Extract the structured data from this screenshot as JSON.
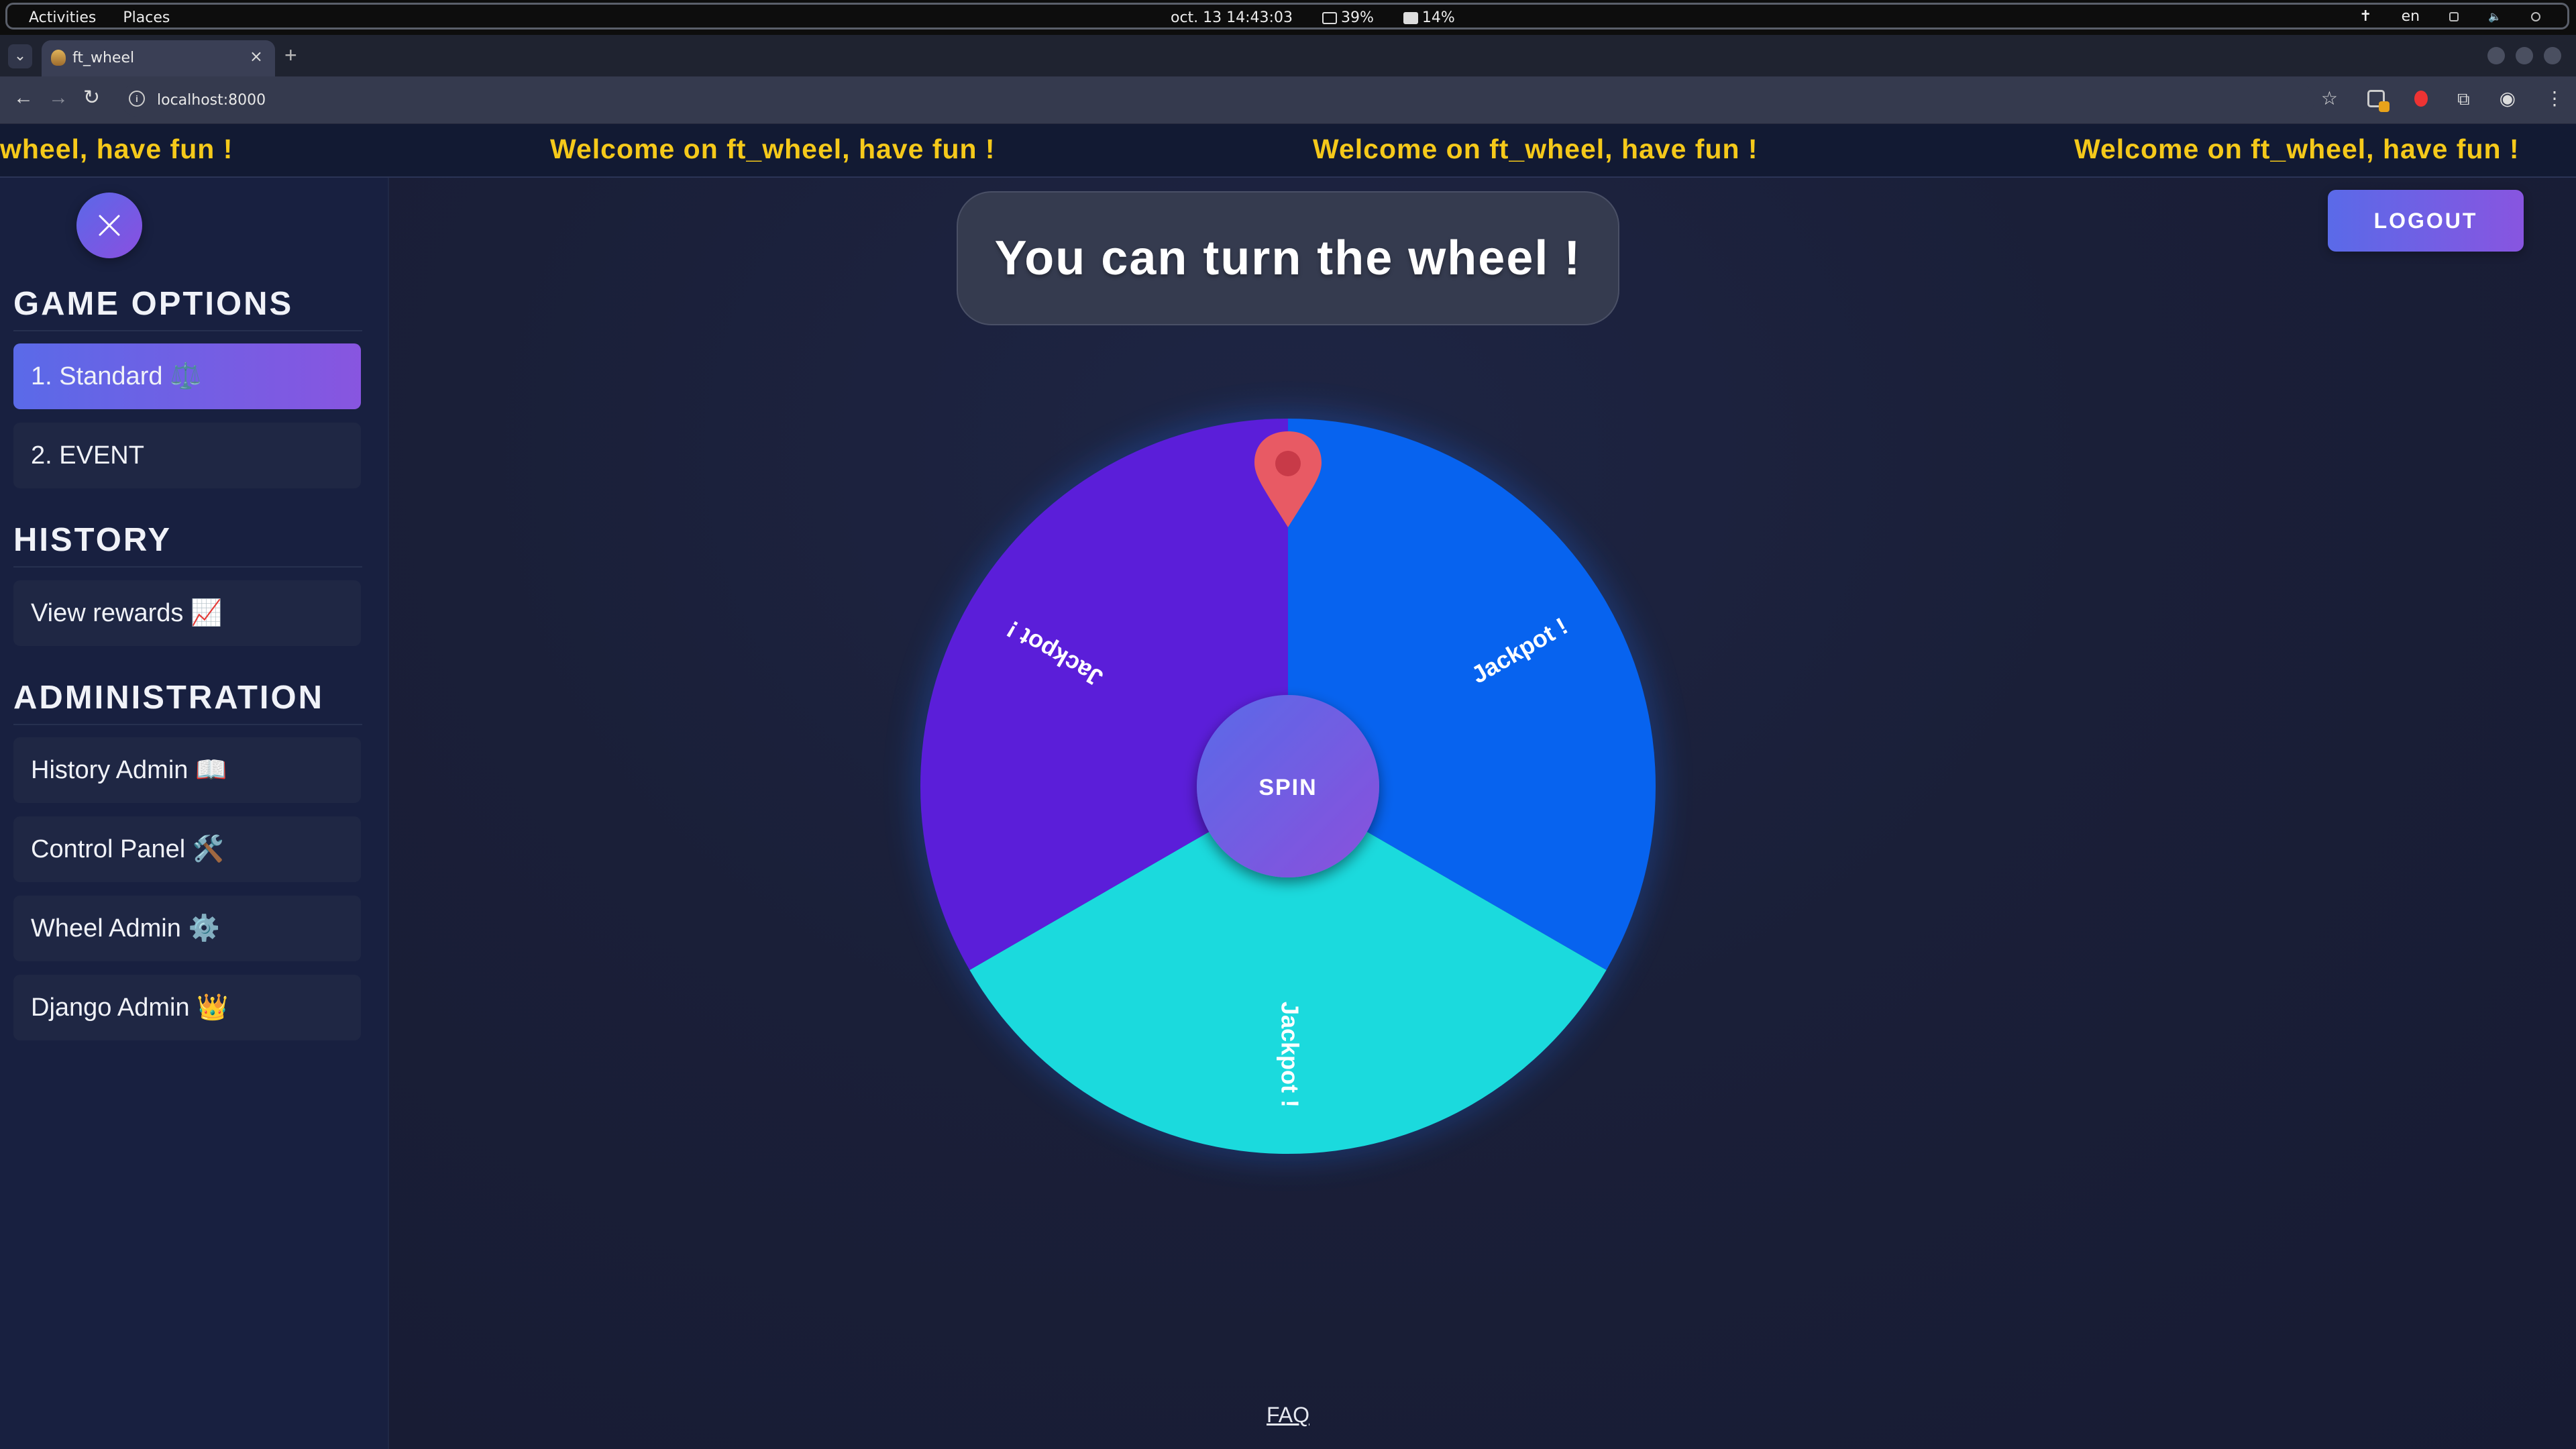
{
  "system_bar": {
    "activities": "Activities",
    "places": "Places",
    "datetime": "oct. 13  14:43:03",
    "cpu": "39%",
    "mem": "14%",
    "lang": "en"
  },
  "browser": {
    "tab_title": "ft_wheel",
    "url": "localhost:8000"
  },
  "banner": {
    "items": [
      "wheel, have fun !",
      "Welcome on ft_wheel, have fun !",
      "Welcome on ft_wheel, have fun !",
      "Welcome on ft_wheel, have fun !"
    ]
  },
  "sidebar": {
    "game_options_title": "GAME OPTIONS",
    "game_options": [
      {
        "label": "1. Standard ⚖️",
        "active": true
      },
      {
        "label": "2. EVENT",
        "active": false
      }
    ],
    "history_title": "HISTORY",
    "history_items": [
      {
        "label": "View rewards 📈"
      }
    ],
    "admin_title": "ADMINISTRATION",
    "admin_items": [
      {
        "label": "History Admin 📖"
      },
      {
        "label": "Control Panel 🛠️"
      },
      {
        "label": "Wheel Admin ⚙️"
      },
      {
        "label": "Django Admin 👑"
      }
    ]
  },
  "main": {
    "message": "You can turn the wheel !",
    "logout_label": "LOGOUT",
    "faq_label": "FAQ"
  },
  "wheel": {
    "spin_label": "SPIN",
    "segments": [
      {
        "label": "Jackpot !",
        "color": "#0763ef"
      },
      {
        "label": "Jackpot !",
        "color": "#1bdadd"
      },
      {
        "label": "Jackpot !",
        "color": "#5b1ed9"
      }
    ],
    "pointer_color": "#e85a64"
  }
}
